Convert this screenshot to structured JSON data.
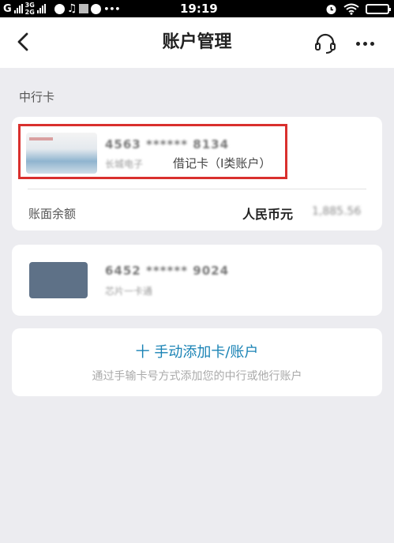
{
  "status_bar": {
    "carrier1": "G",
    "network_top": "3G",
    "network_bottom": "2G",
    "time": "19:19",
    "more": "•••"
  },
  "nav": {
    "title": "账户管理",
    "back_icon": "chevron-left-icon",
    "service_icon": "headset-icon",
    "more_icon": "more-dots-icon"
  },
  "section_label": "中行卡",
  "accounts": [
    {
      "number": "4563 ****** 8134",
      "blurred_prefix": "长城电子",
      "type_label": "借记卡（I类账户）",
      "balance_label": "账面余额",
      "currency": "人民币元",
      "amount": "1,885.56"
    },
    {
      "number": "6452 ****** 9024",
      "subtitle": "芯片一卡通"
    }
  ],
  "add_card": {
    "title": "十 手动添加卡/账户",
    "subtitle": "通过手输卡号方式添加您的中行或他行账户"
  },
  "colors": {
    "accent": "#1a83b5",
    "highlight": "#d9302e"
  }
}
